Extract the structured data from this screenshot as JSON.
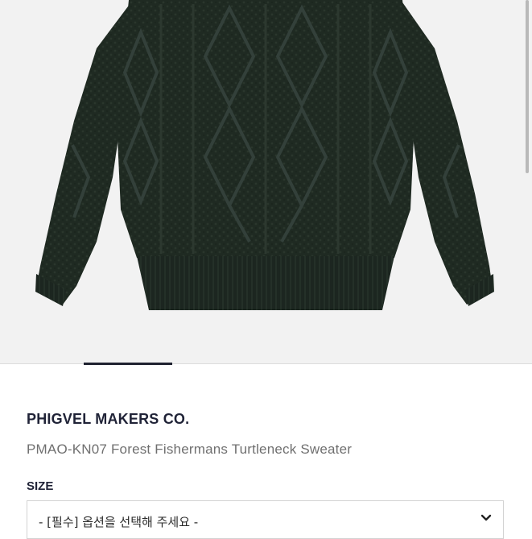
{
  "product": {
    "brand": "PHIGVEL MAKERS CO.",
    "name": "PMAO-KN07 Forest Fishermans Turtleneck Sweater"
  },
  "options": {
    "size_label": "SIZE",
    "size_select_value": "- [필수] 옵션을 선택해 주세요 -"
  },
  "icons": {
    "select_arrow": "chevron-down-icon"
  },
  "colors": {
    "sweater": "#1f2a22",
    "background": "#f2f2f2",
    "text_dark": "#202337",
    "text_muted": "#6f6f6f"
  }
}
